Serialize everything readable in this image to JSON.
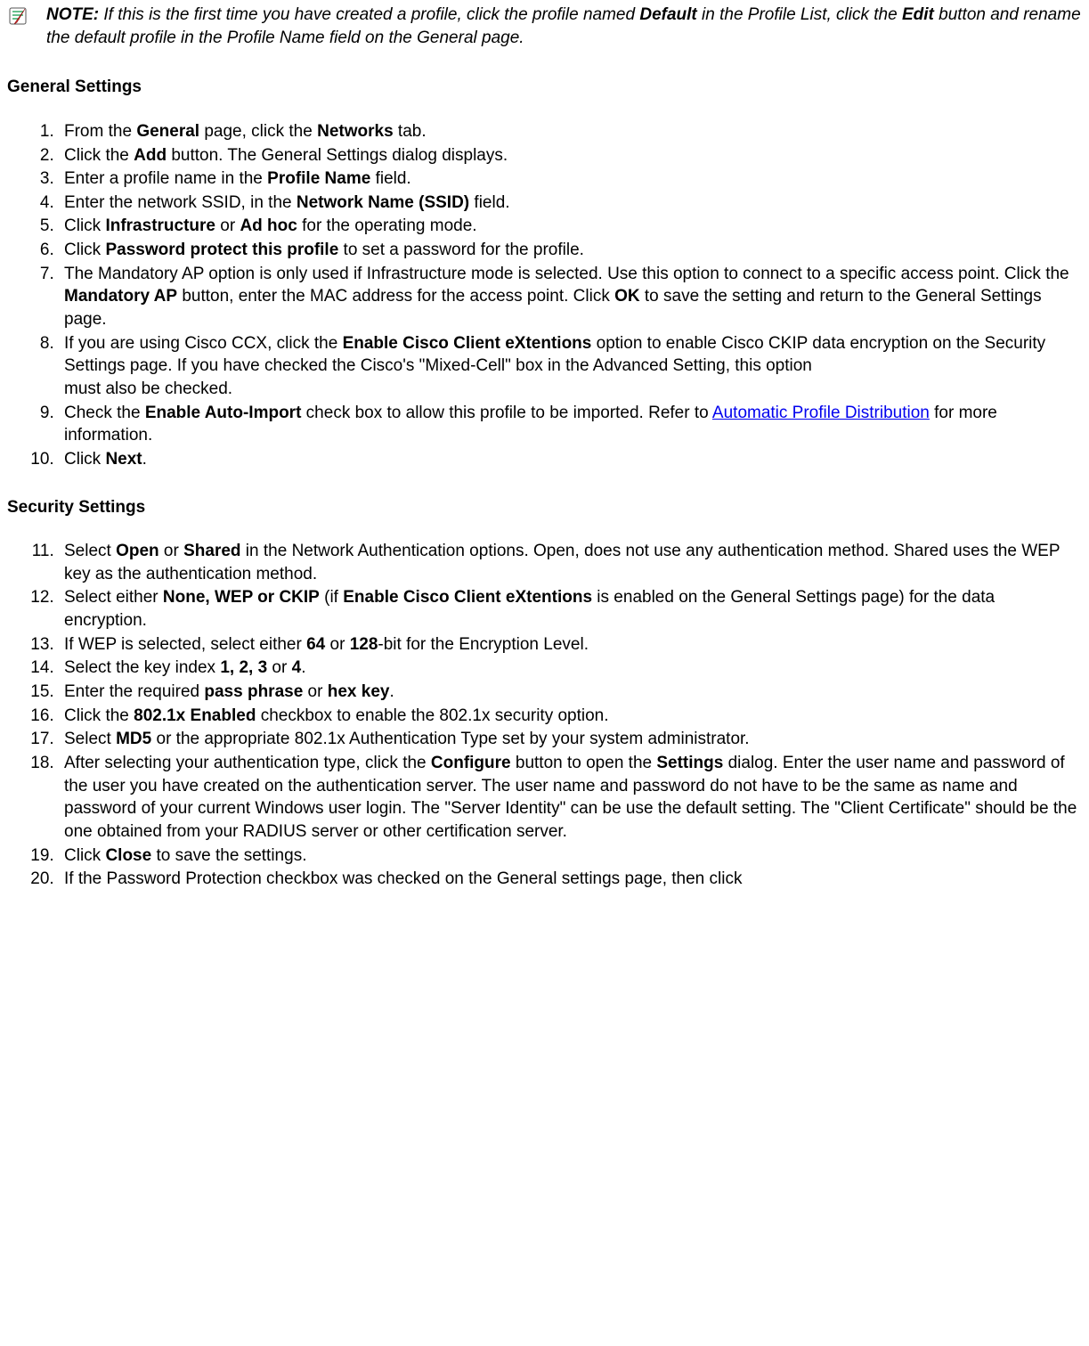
{
  "note": {
    "label": "NOTE:",
    "body_1": " If this is the first time you have created a profile, click the profile named ",
    "b1": "Default",
    "body_2": " in the Profile List, click the ",
    "b2": "Edit",
    "body_3": " button and rename the default profile in the Profile Name field on the General page."
  },
  "h_general": "General Settings",
  "h_security": "Security Settings",
  "g": {
    "i1_a": "From the ",
    "i1_b": "General",
    "i1_c": " page, click the ",
    "i1_d": "Networks",
    "i1_e": " tab.",
    "i2_a": "Click the ",
    "i2_b": "Add",
    "i2_c": " button. The General Settings dialog displays.",
    "i3_a": "Enter a profile name in the ",
    "i3_b": "Profile Name",
    "i3_c": " field.",
    "i4_a": "Enter the network SSID, in the ",
    "i4_b": "Network Name (SSID)",
    "i4_c": " field.",
    "i5_a": "Click ",
    "i5_b": "Infrastructure",
    "i5_c": " or ",
    "i5_d": "Ad hoc",
    "i5_e": " for the operating mode.",
    "i6_a": "Click ",
    "i6_b": "Password protect this profile",
    "i6_c": " to set a password for the profile.",
    "i7_a": "The Mandatory AP option is only used if Infrastructure mode is selected. Use this option to connect to a specific access point. Click the ",
    "i7_b": "Mandatory AP",
    "i7_c": " button, enter the MAC address for the access point. Click ",
    "i7_d": "OK",
    "i7_e": " to save the setting and return to the General Settings page.",
    "i8_a": "If you are using Cisco CCX, click the ",
    "i8_b": "Enable Cisco Client eXtentions",
    "i8_c": " option to enable Cisco CKIP data encryption on the Security Settings page. If you have checked the Cisco's \"Mixed-Cell\" box in the Advanced Setting, this option",
    "i8_d": "must also be checked.",
    "i9_a": "Check the ",
    "i9_b": "Enable Auto-Import",
    "i9_c": " check box to allow this profile to be imported. Refer to ",
    "i9_link": "Automatic Profile Distribution",
    "i9_d": " for more information.",
    "i10_a": "Click ",
    "i10_b": "Next",
    "i10_c": "."
  },
  "s": {
    "i11_a": "Select ",
    "i11_b": "Open",
    "i11_c": " or ",
    "i11_d": "Shared",
    "i11_e": " in the Network Authentication options. Open, does not use any authentication method. Shared uses the WEP key as the authentication method.",
    "i12_a": "Select either ",
    "i12_b": "None, WEP  or CKIP",
    "i12_c": " (if ",
    "i12_d": "Enable Cisco Client eXtentions",
    "i12_e": " is enabled on the General Settings page) for the data encryption.",
    "i13_a": "If WEP is selected, select either ",
    "i13_b": "64",
    "i13_c": " or ",
    "i13_d": "128",
    "i13_e": "-bit for the Encryption Level.",
    "i14_a": "Select the key index ",
    "i14_b": "1, 2, 3",
    "i14_c": " or ",
    "i14_d": "4",
    "i14_e": ".",
    "i15_a": "Enter the required ",
    "i15_b": "pass phrase",
    "i15_c": " or ",
    "i15_d": "hex key",
    "i15_e": ".",
    "i16_a": "Click the ",
    "i16_b": "802.1x Enabled",
    "i16_c": " checkbox to enable the 802.1x security option.",
    "i17_a": "Select ",
    "i17_b": "MD5",
    "i17_c": " or the appropriate 802.1x Authentication Type set by your system administrator.",
    "i18_a": "After selecting your authentication type, click the ",
    "i18_b": "Configure",
    "i18_c": " button to open the ",
    "i18_d": "Settings",
    "i18_e": " dialog. Enter the user name and password of the user you have created on the authentication server. The user name and password do not have to be the same as name and password of your current Windows user login. The \"Server Identity\" can be use the default setting. The \"Client Certificate\" should be the one obtained from your RADIUS server or other certification server.",
    "i19_a": "Click ",
    "i19_b": "Close",
    "i19_c": " to save the settings.",
    "i20_a": "If the Password Protection checkbox was checked on the General settings page, then click"
  }
}
